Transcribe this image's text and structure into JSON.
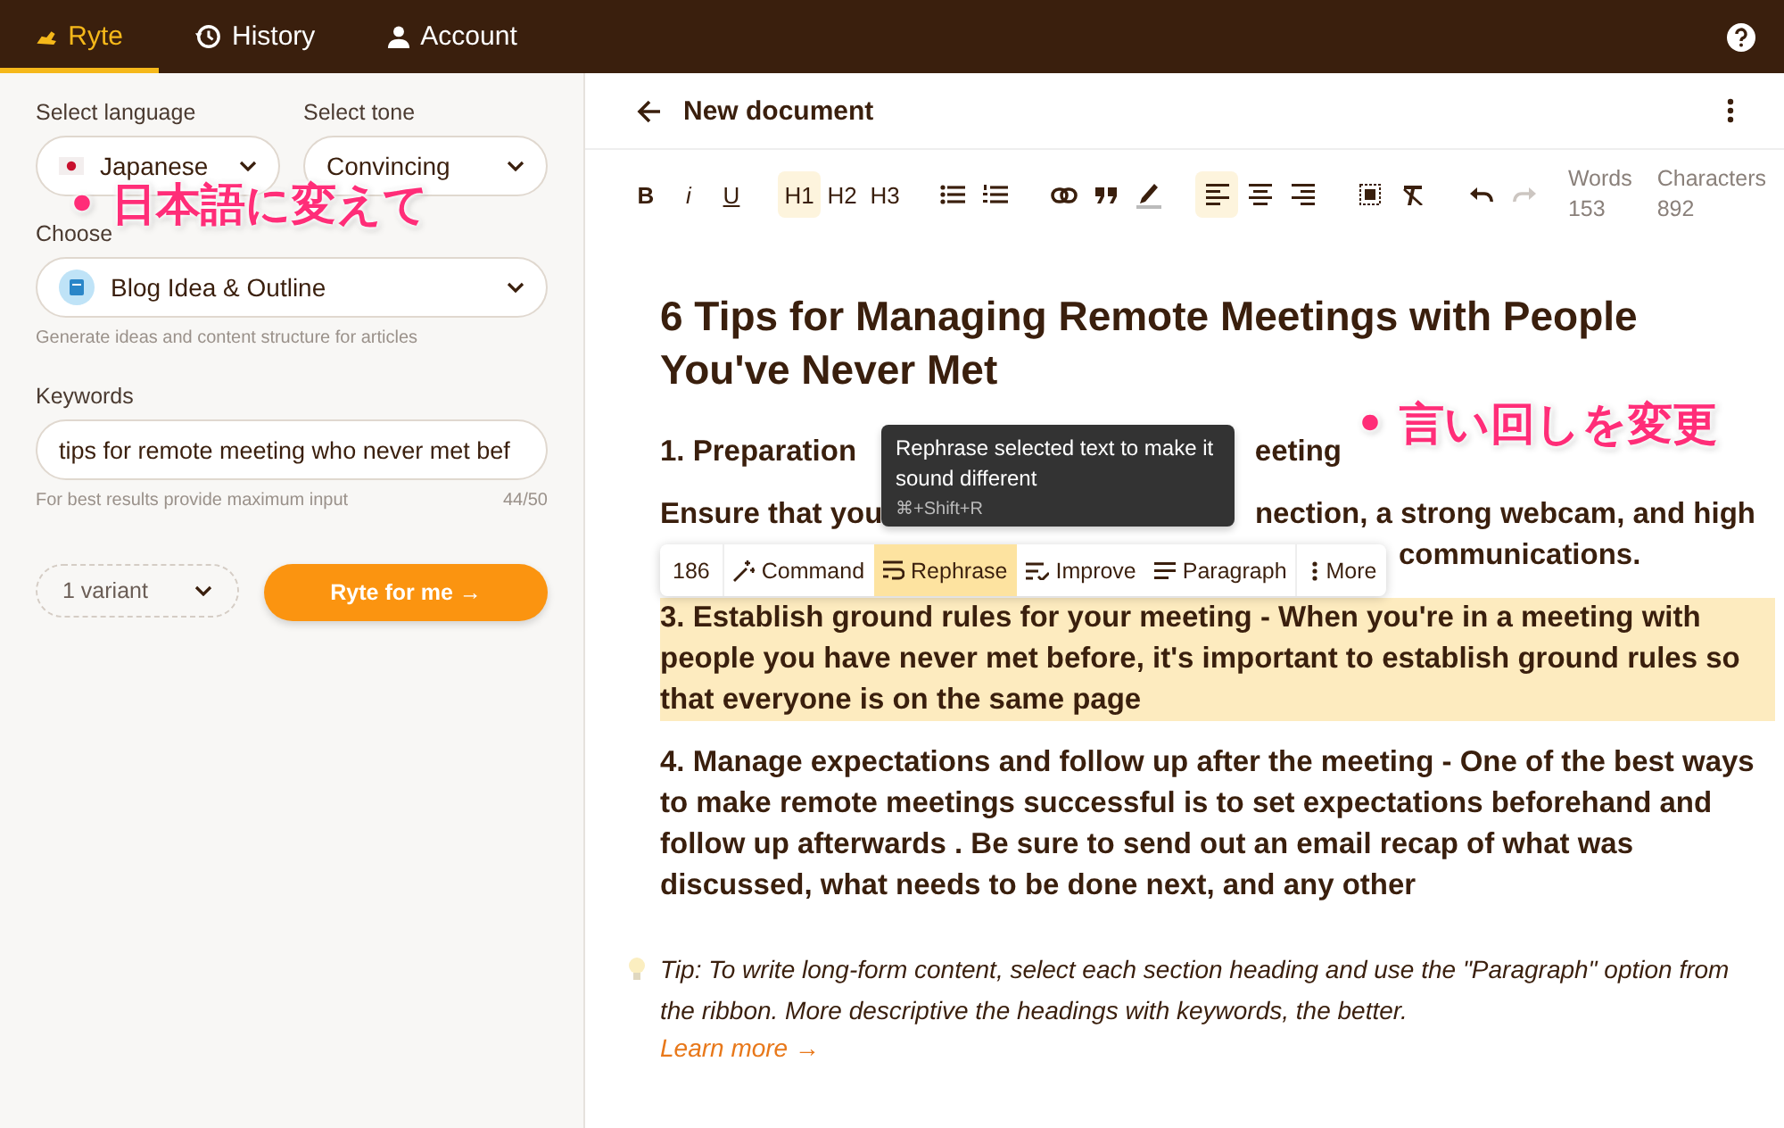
{
  "header": {
    "tabs": [
      {
        "label": "Ryte",
        "selected": true
      },
      {
        "label": "History",
        "selected": false
      },
      {
        "label": "Account",
        "selected": false
      }
    ]
  },
  "sidebar": {
    "language": {
      "label": "Select language",
      "value": "Japanese"
    },
    "tone": {
      "label": "Select tone",
      "value": "Convincing"
    },
    "use_case": {
      "label": "Choose",
      "value": "Blog Idea & Outline",
      "hint": "Generate ideas and content structure for articles"
    },
    "keywords": {
      "label": "Keywords",
      "value": "tips for remote meeting who never met bef",
      "hint": "For best results provide maximum input",
      "count": "44/50"
    },
    "variants": "1 variant",
    "generate_button": "Ryte for me →"
  },
  "editor": {
    "title": "New document",
    "toolbar": [
      {
        "kind": "text",
        "label": "B",
        "active": false
      },
      {
        "kind": "text",
        "label": "i",
        "active": false
      },
      {
        "kind": "text",
        "label": "U",
        "active": false
      },
      {
        "kind": "text",
        "label": "H1",
        "active": true
      },
      {
        "kind": "text",
        "label": "H2",
        "active": false
      },
      {
        "kind": "text",
        "label": "H3",
        "active": false
      },
      {
        "kind": "icon",
        "active": false
      },
      {
        "kind": "icon",
        "active": false
      },
      {
        "kind": "icon",
        "active": false
      },
      {
        "kind": "icon",
        "active": false
      },
      {
        "kind": "icon",
        "active": false
      },
      {
        "kind": "icon",
        "active": true
      },
      {
        "kind": "icon",
        "active": false
      },
      {
        "kind": "icon",
        "active": false
      },
      {
        "kind": "icon",
        "active": false
      },
      {
        "kind": "icon",
        "active": false
      },
      {
        "kind": "icon",
        "disabled": false
      },
      {
        "kind": "icon",
        "disabled": true
      }
    ],
    "stats": [
      {
        "label": "Words",
        "value": "153"
      },
      {
        "label": "Characters",
        "value": "892"
      }
    ],
    "document": {
      "title": "6 Tips for Managing Remote Meetings with People You've Never Met",
      "blocks": [
        {
          "kind": "split",
          "parts": [
            "1. Preparation",
            "eeting"
          ]
        },
        {
          "kind": "covered",
          "parts": [
            "Ensure that you",
            "nection, a strong webcam, and high",
            "communications."
          ]
        },
        {
          "kind": "paragraph",
          "text": "3. Establish ground rules for your meeting - When you're in a meeting with people you have never met before, it's important to establish ground rules so that everyone is on the same page",
          "selected": true
        },
        {
          "kind": "paragraph",
          "text": "4. Manage expectations and follow up after the meeting - One of the best ways to make remote meetings successful is to set expectations beforehand and follow up afterwards . Be sure to send out an email recap of what was discussed, what needs to be done next, and any other",
          "selected": false
        }
      ],
      "tip": {
        "text": "Tip: To write long-form content, select each section heading and use the \"Paragraph\" option from the ribbon. More descriptive the headings with keywords, the better.",
        "link": "Learn more →"
      }
    },
    "selection_toolbar": {
      "count": "186",
      "items": [
        {
          "label": "Command",
          "selected": false
        },
        {
          "label": "Rephrase",
          "selected": true
        },
        {
          "label": "Improve",
          "selected": false
        },
        {
          "label": "Paragraph",
          "selected": false
        },
        {
          "label": "More",
          "selected": false
        }
      ]
    },
    "tooltip": {
      "text": "Rephrase selected text to make it sound different",
      "shortcut": "⌘+Shift+R"
    }
  },
  "annotations": [
    "• 日本語に変えて",
    "• 言い回しを変更"
  ]
}
